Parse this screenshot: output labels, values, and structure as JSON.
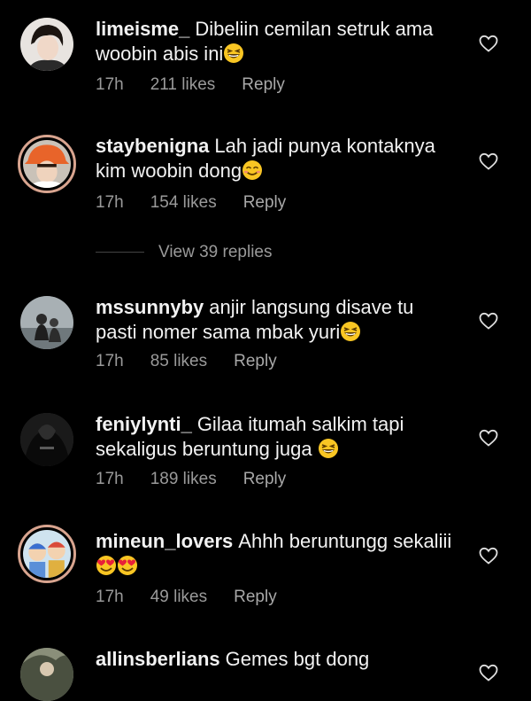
{
  "comments": [
    {
      "username": "limeisme_",
      "line1": "Dibeliin cemilan setruk ama",
      "line2": "woobin abis ini",
      "time": "17h",
      "likes": "211 likes",
      "reply": "Reply"
    },
    {
      "username": "staybenigna",
      "line1": "Lah jadi punya kontaknya",
      "line2": "kim woobin dong",
      "time": "17h",
      "likes": "154 likes",
      "reply": "Reply"
    },
    {
      "username": "mssunnyby",
      "line1": "anjir langsung disave tu",
      "line2": "pasti nomer sama mbak yuri",
      "time": "17h",
      "likes": "85 likes",
      "reply": "Reply"
    },
    {
      "username": "feniylynti_",
      "line1": "Gilaa itumah salkim tapi",
      "line2": "sekaligus beruntung juga",
      "time": "17h",
      "likes": "189 likes",
      "reply": "Reply"
    },
    {
      "username": "mineun_lovers",
      "line1": "Ahhh beruntungg sekaliii",
      "line2": "",
      "time": "17h",
      "likes": "49 likes",
      "reply": "Reply"
    },
    {
      "username": "allinsberlians",
      "line1": "Gemes bgt dong",
      "line2": ""
    }
  ],
  "view_replies_label": "View 39 replies",
  "icons": {
    "like": "heart-outline-icon",
    "grin": "grinning-squinting-face-emoji",
    "smile": "smiling-face-emoji",
    "heart_eyes": "heart-eyes-emoji"
  },
  "colors": {
    "background": "#000000",
    "text": "#f2f2f2",
    "meta": "#9a9a9a",
    "story_ring": "#d8a48f"
  }
}
